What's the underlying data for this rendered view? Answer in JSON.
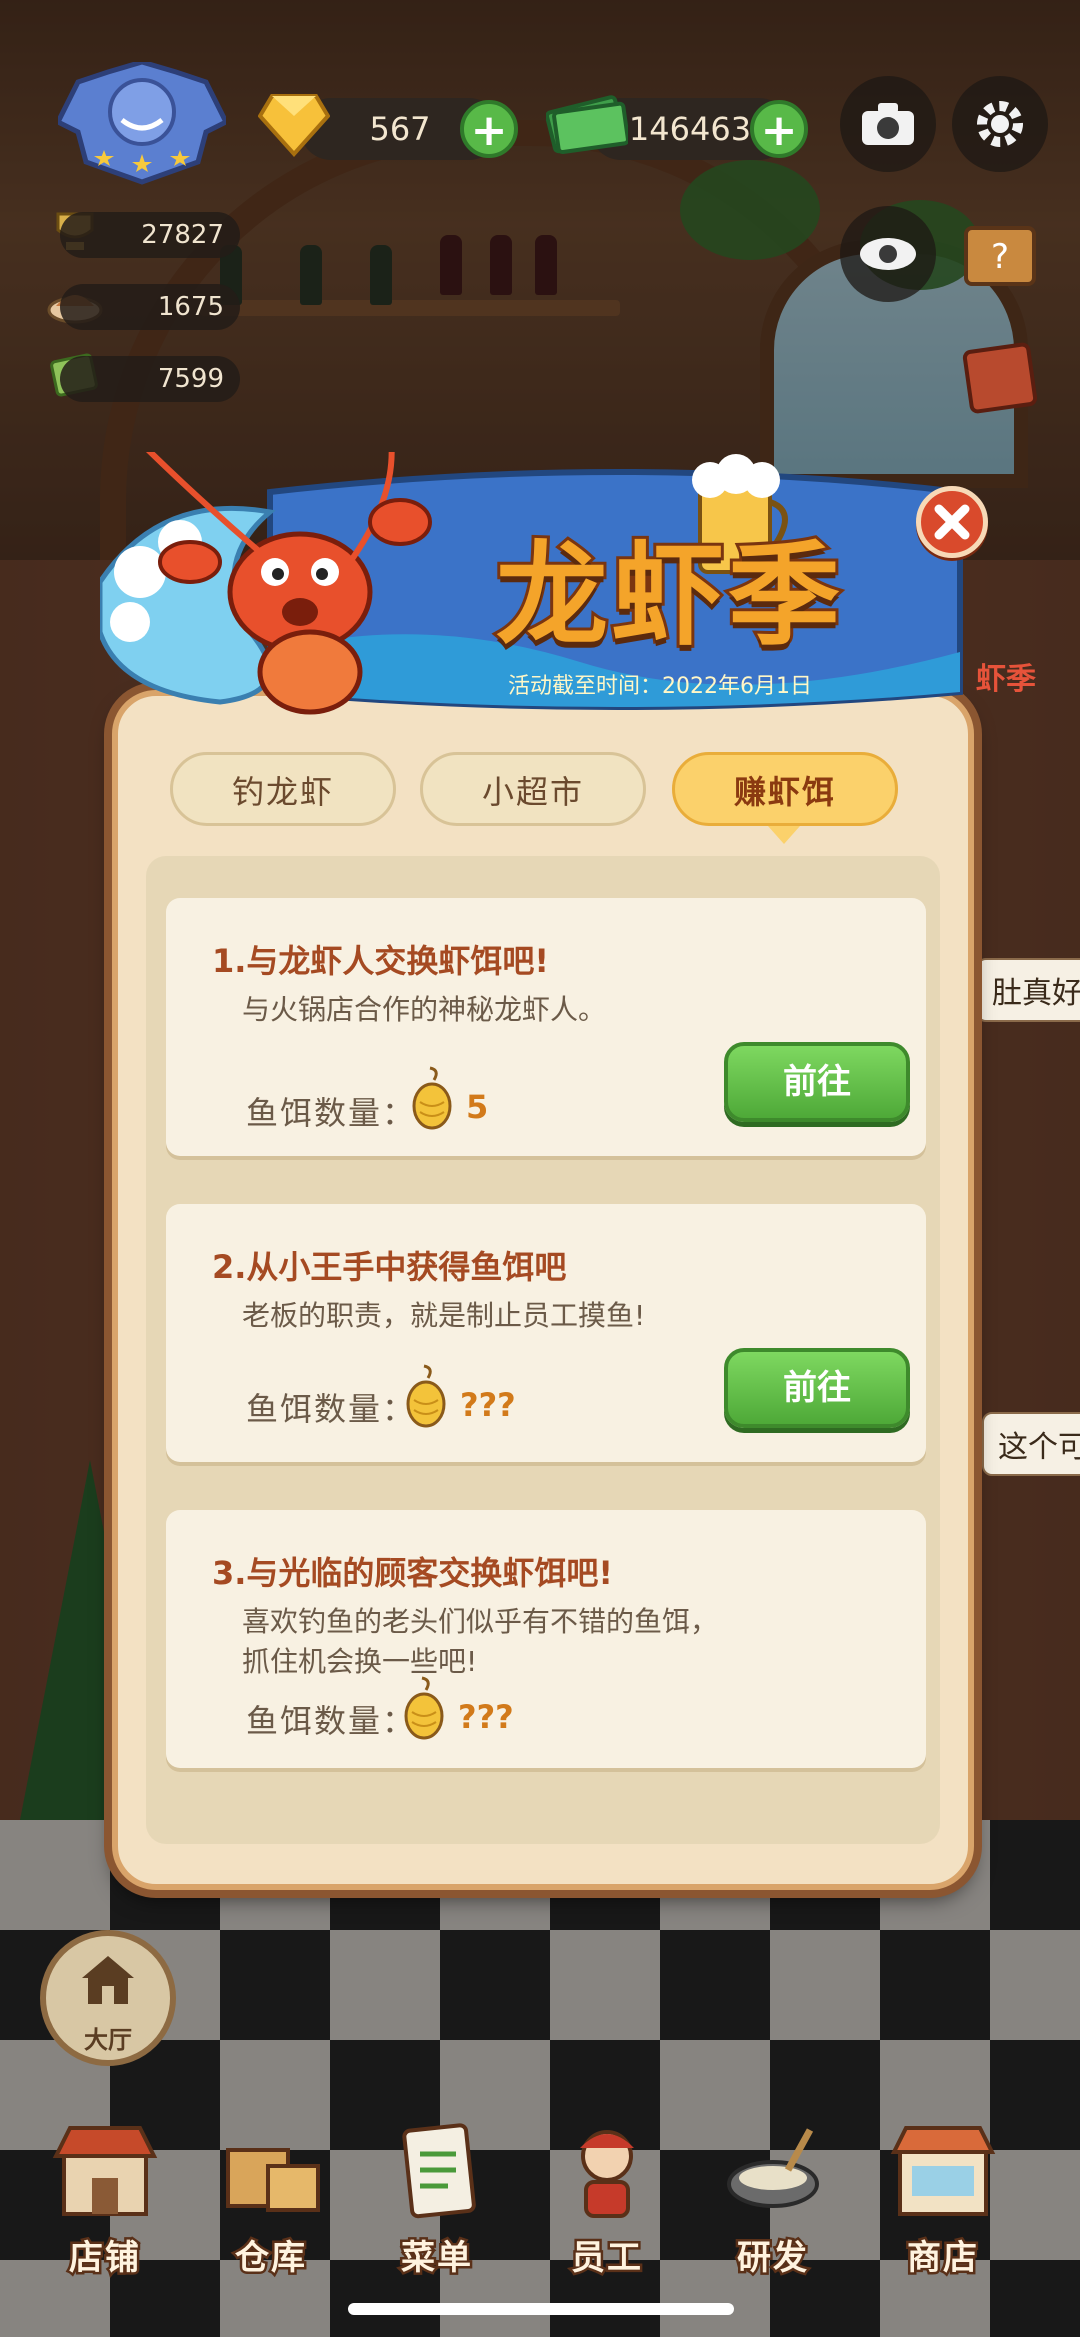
{
  "hud": {
    "gems": "567",
    "cash": "146463",
    "stats": [
      "27827",
      "1675",
      "7599"
    ],
    "plus": "+"
  },
  "banner": {
    "title": "龙虾季",
    "deadline": "活动截至时间：2022年6月1日"
  },
  "tabs": [
    {
      "label": "钓龙虾",
      "active": false
    },
    {
      "label": "小超市",
      "active": false
    },
    {
      "label": "赚虾饵",
      "active": true
    }
  ],
  "tasks": [
    {
      "title": "1.与龙虾人交换虾饵吧!",
      "desc": "与火锅店合作的神秘龙虾人。",
      "bait_label": "鱼饵数量：",
      "bait_value": "5",
      "button": "前往"
    },
    {
      "title": "2.从小王手中获得鱼饵吧",
      "desc": "老板的职责，就是制止员工摸鱼!",
      "bait_label": "鱼饵数量：",
      "bait_value": "???",
      "button": "前往"
    },
    {
      "title": "3.与光临的顾客交换虾饵吧!",
      "desc": "喜欢钓鱼的老头们似乎有不错的鱼饵，抓住机会换一些吧!",
      "bait_label": "鱼饵数量：",
      "bait_value": "???"
    }
  ],
  "side_texts": [
    "虾季",
    "肚真好",
    "这个可"
  ],
  "hall": {
    "label": "大厅"
  },
  "nav": [
    {
      "label": "店铺",
      "icon": "shop-icon"
    },
    {
      "label": "仓库",
      "icon": "warehouse-icon"
    },
    {
      "label": "菜单",
      "icon": "menu-icon"
    },
    {
      "label": "员工",
      "icon": "staff-icon"
    },
    {
      "label": "研发",
      "icon": "research-icon"
    },
    {
      "label": "商店",
      "icon": "store-icon"
    }
  ],
  "colors": {
    "accent_green": "#58b948",
    "title_orange": "#f4a42a",
    "card_title": "#a54a22"
  }
}
